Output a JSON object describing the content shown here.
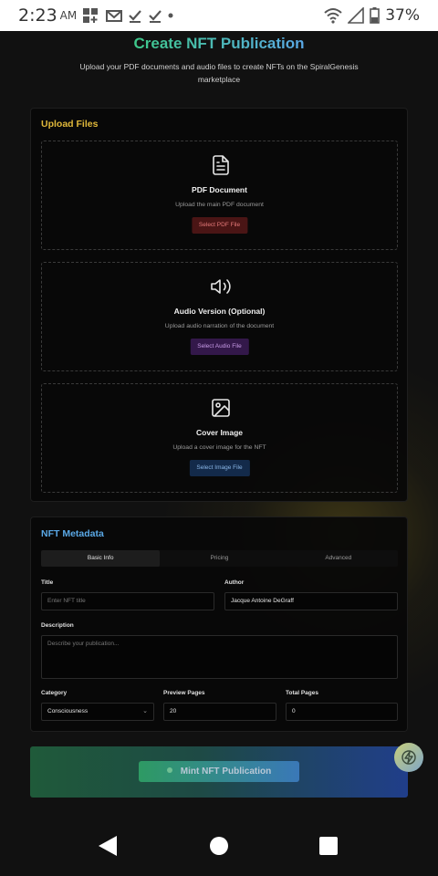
{
  "status_bar": {
    "time": "2:23",
    "ampm": "AM",
    "battery_pct": "37%",
    "left_icons": [
      "grid-add-icon",
      "mail-icon",
      "check-icon",
      "check-icon",
      "dot-icon"
    ],
    "right_icons": [
      "wifi-icon",
      "signal-icon",
      "battery-icon"
    ]
  },
  "header": {
    "title": "Create NFT Publication",
    "subtitle": "Upload your PDF documents and audio files to create NFTs on the SpiralGenesis marketplace"
  },
  "upload": {
    "title": "Upload Files",
    "pdf": {
      "icon": "document-icon",
      "title": "PDF Document",
      "desc": "Upload the main PDF document",
      "button": "Select PDF File"
    },
    "audio": {
      "icon": "speaker-icon",
      "title": "Audio Version (Optional)",
      "desc": "Upload audio narration of the document",
      "button": "Select Audio File"
    },
    "cover": {
      "icon": "image-icon",
      "title": "Cover Image",
      "desc": "Upload a cover image for the NFT",
      "button": "Select Image File"
    }
  },
  "metadata": {
    "title": "NFT Metadata",
    "tabs": [
      "Basic Info",
      "Pricing",
      "Advanced"
    ],
    "active_tab": "Basic Info",
    "fields": {
      "title_label": "Title",
      "title_placeholder": "Enter NFT title",
      "author_label": "Author",
      "author_value": "Jacque Antoine DeGraff",
      "description_label": "Description",
      "description_placeholder": "Describe your publication...",
      "category_label": "Category",
      "category_value": "Consciousness",
      "preview_label": "Preview Pages",
      "preview_value": "20",
      "total_label": "Total Pages",
      "total_value": "0"
    }
  },
  "mint": {
    "button": "Mint NFT Publication"
  },
  "colors": {
    "upload_title": "#e0b83a",
    "metadata_title": "#5aa8e6",
    "title_gradient_start": "#3ec98a",
    "title_gradient_end": "#5aa8e6"
  }
}
